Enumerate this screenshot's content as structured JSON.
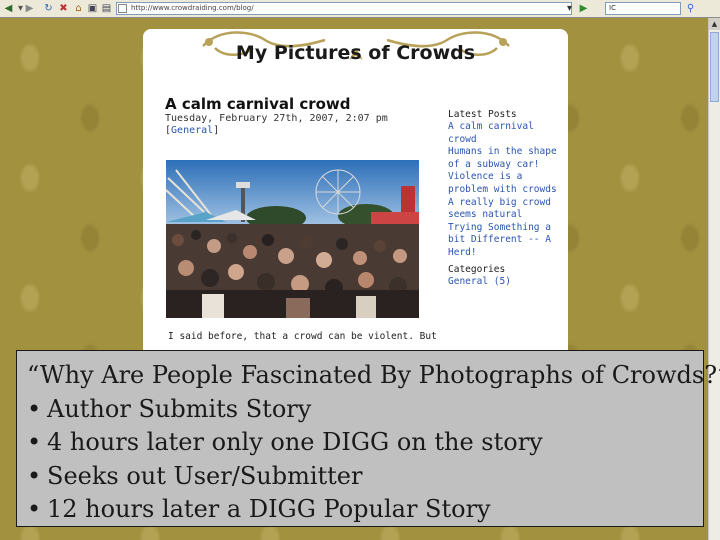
{
  "browser": {
    "address": "http://www.crowdraiding.com/blog/",
    "search_value": "IC"
  },
  "site": {
    "title": "My Pictures of Crowds"
  },
  "post": {
    "title": "A calm carnival crowd",
    "date": "Tuesday, February 27th, 2007, 2:07 pm",
    "category_prefix": "[",
    "category": "General",
    "category_suffix": "]",
    "excerpt": "I said before, that a crowd can be violent. But"
  },
  "sidebar": {
    "latest_heading": "Latest Posts",
    "latest_posts": [
      "A calm carnival crowd",
      "Humans in the shape of a subway car!",
      "Violence is a problem with crowds",
      "A really big crowd seems natural",
      "Trying Something a bit Different -- A Herd!"
    ],
    "categories_heading": "Categories",
    "categories": [
      "General (5)"
    ]
  },
  "caption": {
    "lines": [
      "“Why Are People Fascinated By Photographs of Crowds?”",
      "Author Submits Story",
      "4 hours later only one DIGG on the story",
      "Seeks out User/Submitter",
      "12 hours later a DIGG Popular Story"
    ],
    "bullet": "•"
  },
  "colors": {
    "background": "#a2913f",
    "link": "#2a55b0",
    "caption_bg": "#c0c0c0"
  }
}
